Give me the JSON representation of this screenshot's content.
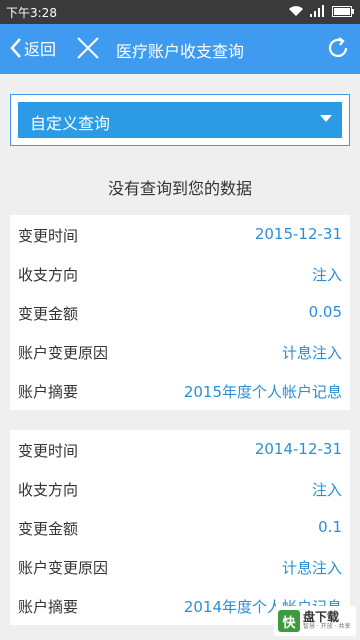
{
  "status": {
    "time": "下午3:28"
  },
  "nav": {
    "back_label": "返回",
    "title": "医疗账户收支查询"
  },
  "query": {
    "selected": "自定义查询"
  },
  "empty_message": "没有查询到您的数据",
  "records": [
    {
      "rows": [
        {
          "key": "变更时间",
          "value": "2015-12-31"
        },
        {
          "key": "收支方向",
          "value": "注入"
        },
        {
          "key": "变更金额",
          "value": "0.05"
        },
        {
          "key": "账户变更原因",
          "value": "计息注入"
        },
        {
          "key": "账户摘要",
          "value": "2015年度个人帐户记息"
        }
      ]
    },
    {
      "rows": [
        {
          "key": "变更时间",
          "value": "2014-12-31"
        },
        {
          "key": "收支方向",
          "value": "注入"
        },
        {
          "key": "变更金额",
          "value": "0.1"
        },
        {
          "key": "账户变更原因",
          "value": "计息注入"
        },
        {
          "key": "账户摘要",
          "value": "2014年度个人帐户记息"
        }
      ]
    }
  ],
  "watermark": {
    "glyph": "快",
    "text": "盘下载",
    "sub": "智慧 · 开放 · 共享"
  },
  "colors": {
    "navbar": "#3f9bf0",
    "value_text": "#2b8fd6",
    "dropdown": "#2b9be6"
  }
}
